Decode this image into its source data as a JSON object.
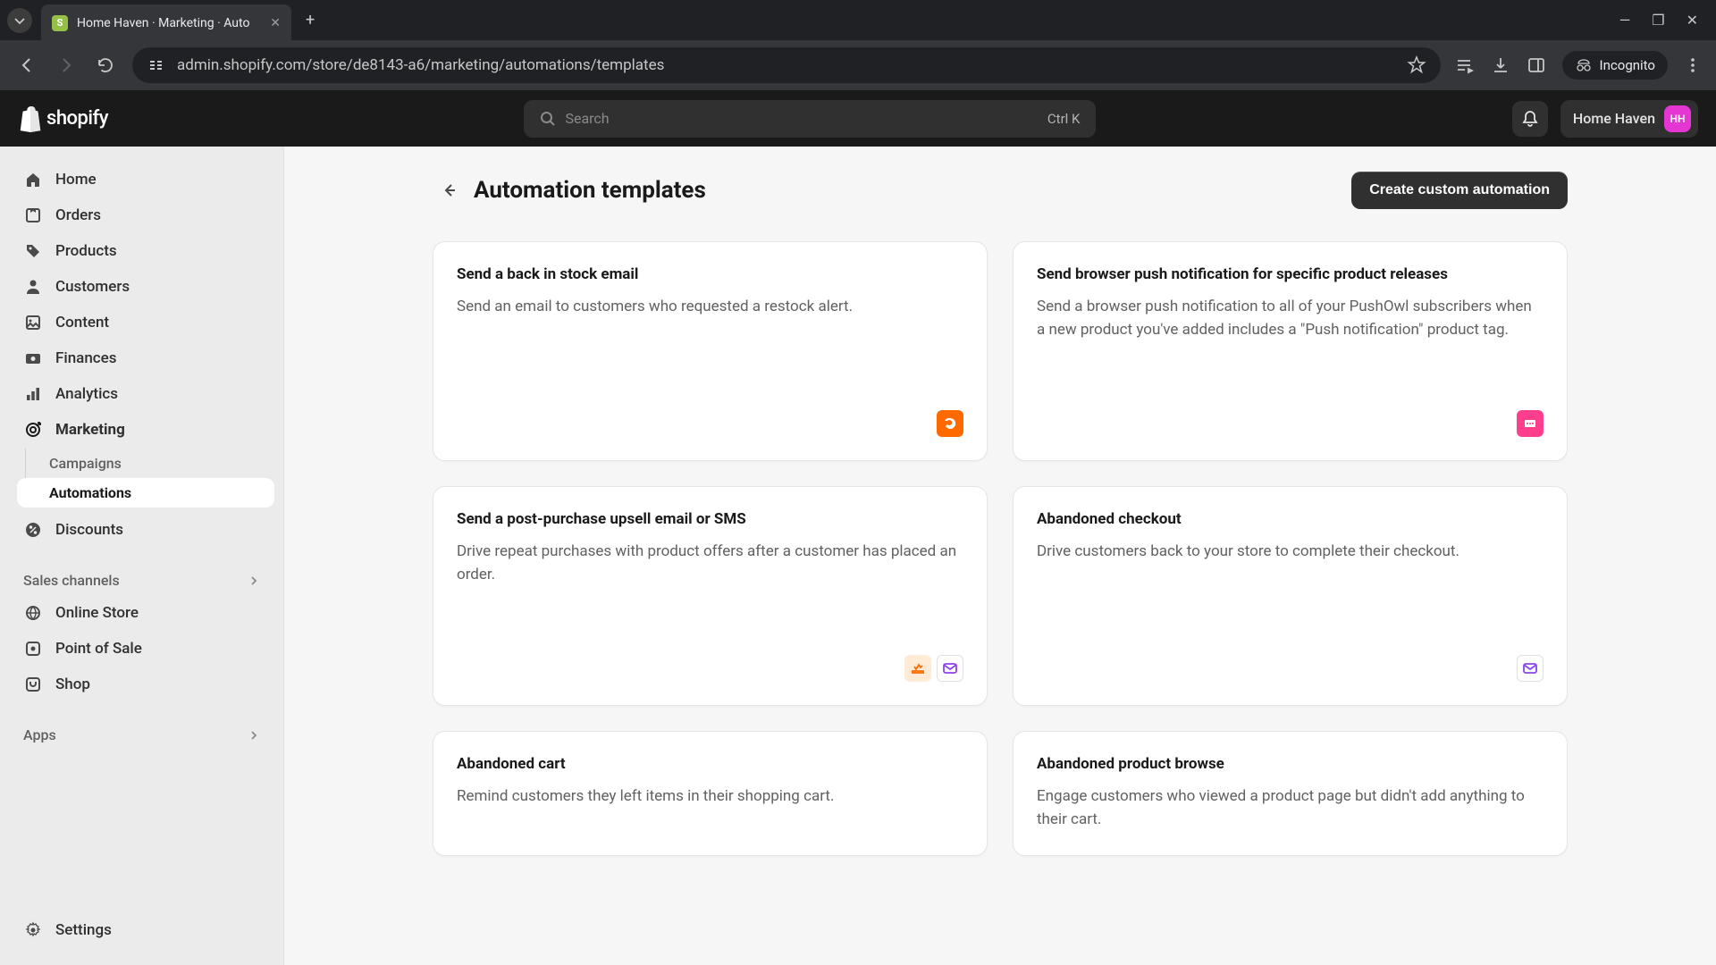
{
  "browser": {
    "tab_title": "Home Haven · Marketing · Auto",
    "url": "admin.shopify.com/store/de8143-a6/marketing/automations/templates",
    "incognito_label": "Incognito"
  },
  "header": {
    "logo_text": "shopify",
    "search_placeholder": "Search",
    "search_shortcut": "Ctrl K",
    "store_name": "Home Haven",
    "store_initials": "HH"
  },
  "sidebar": {
    "items": [
      {
        "label": "Home"
      },
      {
        "label": "Orders"
      },
      {
        "label": "Products"
      },
      {
        "label": "Customers"
      },
      {
        "label": "Content"
      },
      {
        "label": "Finances"
      },
      {
        "label": "Analytics"
      },
      {
        "label": "Marketing"
      },
      {
        "label": "Discounts"
      }
    ],
    "marketing_sub": [
      {
        "label": "Campaigns"
      },
      {
        "label": "Automations"
      }
    ],
    "sales_channels_label": "Sales channels",
    "channels": [
      {
        "label": "Online Store"
      },
      {
        "label": "Point of Sale"
      },
      {
        "label": "Shop"
      }
    ],
    "apps_label": "Apps",
    "settings_label": "Settings"
  },
  "page": {
    "title": "Automation templates",
    "create_button": "Create custom automation"
  },
  "templates": [
    {
      "title": "Send a back in stock email",
      "desc": "Send an email to customers who requested a restock alert."
    },
    {
      "title": "Send browser push notification for specific product releases",
      "desc": "Send a browser push notification to all of your PushOwl subscribers when a new product you've added includes a \"Push notification\" product tag."
    },
    {
      "title": "Send a post-purchase upsell email or SMS",
      "desc": "Drive repeat purchases with product offers after a customer has placed an order."
    },
    {
      "title": "Abandoned checkout",
      "desc": "Drive customers back to your store to complete their checkout."
    },
    {
      "title": "Abandoned cart",
      "desc": "Remind customers they left items in their shopping cart."
    },
    {
      "title": "Abandoned product browse",
      "desc": "Engage customers who viewed a product page but didn't add anything to their cart."
    }
  ]
}
